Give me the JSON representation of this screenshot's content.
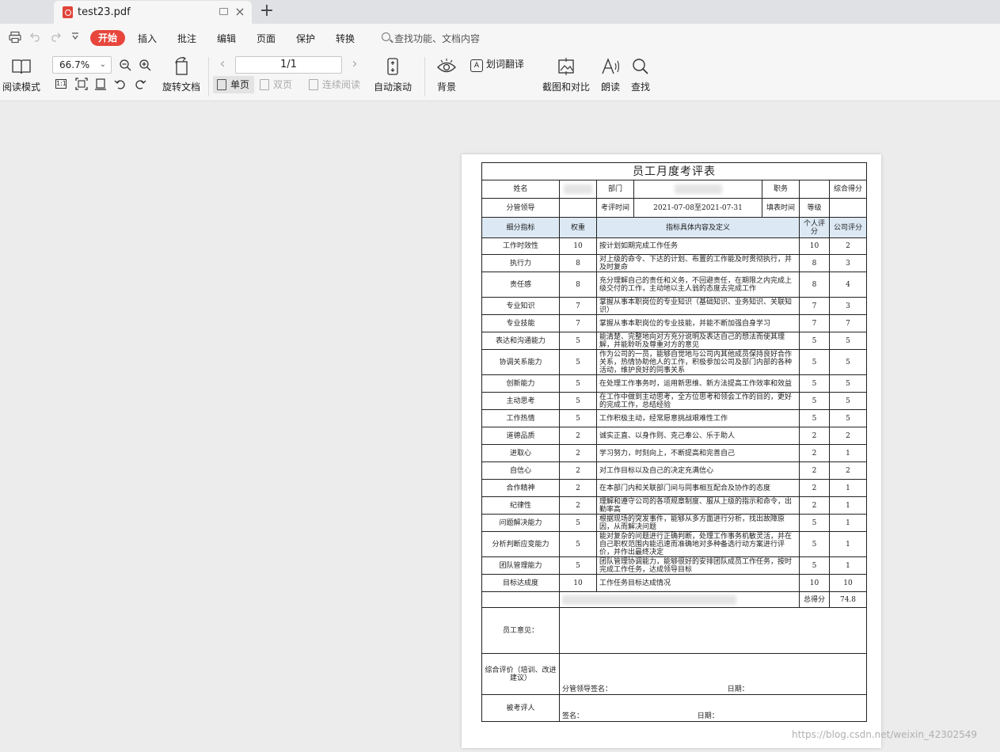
{
  "tab": {
    "title": "test23.pdf",
    "close_glyph": "×",
    "add_glyph": "+"
  },
  "menu": {
    "start": "开始",
    "items": [
      "插入",
      "批注",
      "编辑",
      "页面",
      "保护",
      "转换"
    ],
    "search_placeholder": "查找功能、文档内容"
  },
  "toolbar": {
    "reading_mode": "阅读模式",
    "zoom": "66.7%",
    "rotate_doc": "旋转文档",
    "page_indicator": "1/1",
    "single_page": "单页",
    "double_page": "双页",
    "continuous": "连续阅读",
    "auto_scroll": "自动滚动",
    "background": "背景",
    "translate": "划词翻译",
    "screenshot_compare": "截图和对比",
    "read_aloud": "朗读",
    "find": "查找"
  },
  "form": {
    "title": "员工月度考评表",
    "name_label": "姓名",
    "dept_label": "部门",
    "position_label": "职务",
    "overall_score_label": "综合得分",
    "supervisor_label": "分管领导",
    "eval_period_label": "考评时间",
    "eval_period": "2021-07-08至2021-07-31",
    "fill_time_label": "填表时间",
    "grade_label": "等级",
    "col_indicator": "细分指标",
    "col_weight": "权重",
    "col_definition": "指标具体内容及定义",
    "col_self": "个人评分",
    "col_company": "公司评分",
    "rows": [
      {
        "indicator": "工作时效性",
        "weight": "10",
        "definition": "按计划如期完成工作任务",
        "self": "10",
        "company": "2"
      },
      {
        "indicator": "执行力",
        "weight": "8",
        "definition": "对上级的命令、下达的计划、布置的工作能及时贯彻执行，并及时复命",
        "self": "8",
        "company": "3"
      },
      {
        "indicator": "责任感",
        "weight": "8",
        "definition": "充分理解自己的责任和义务，不回避责任，在期限之内完成上级交付的工作，主动地以主人翁的态度去完成工作",
        "self": "8",
        "company": "4"
      },
      {
        "indicator": "专业知识",
        "weight": "7",
        "definition": "掌握从事本职岗位的专业知识（基础知识、业务知识、关联知识）",
        "self": "7",
        "company": "3"
      },
      {
        "indicator": "专业技能",
        "weight": "7",
        "definition": "掌握从事本职岗位的专业技能，并能不断加强自身学习",
        "self": "7",
        "company": "7"
      },
      {
        "indicator": "表达和沟通能力",
        "weight": "5",
        "definition": "能清楚、完整地向对方充分说明及表达自己的想法而使其理解，并能聆听及尊重对方的意见",
        "self": "5",
        "company": "5"
      },
      {
        "indicator": "协调关系能力",
        "weight": "5",
        "definition": "作为公司的一员，能够自觉地与公司内其他成员保持良好合作关系，热情协助他人的工作，积极参加公司及部门内部的各种活动，维护良好的同事关系",
        "self": "5",
        "company": "5"
      },
      {
        "indicator": "创新能力",
        "weight": "5",
        "definition": "在处理工作事务时，运用新思维、新方法提高工作效率和效益",
        "self": "5",
        "company": "5"
      },
      {
        "indicator": "主动思考",
        "weight": "5",
        "definition": "在工作中做到主动思考，全方位思考和领会工作的目的，更好的完成工作，总结经验",
        "self": "5",
        "company": "5"
      },
      {
        "indicator": "工作热情",
        "weight": "5",
        "definition": "工作积极主动，经常愿意挑战艰难性工作",
        "self": "5",
        "company": "5"
      },
      {
        "indicator": "道德品质",
        "weight": "2",
        "definition": "诚实正直、以身作则、克己奉公、乐于助人",
        "self": "2",
        "company": "2"
      },
      {
        "indicator": "进取心",
        "weight": "2",
        "definition": "学习努力，时刻向上，不断提高和完善自己",
        "self": "2",
        "company": "1"
      },
      {
        "indicator": "自信心",
        "weight": "2",
        "definition": "对工作目标以及自己的决定充满信心",
        "self": "2",
        "company": "2"
      },
      {
        "indicator": "合作精神",
        "weight": "2",
        "definition": "在本部门内和关联部门间与同事相互配合及协作的态度",
        "self": "2",
        "company": "1"
      },
      {
        "indicator": "纪律性",
        "weight": "2",
        "definition": "理解和遵守公司的各项规章制度、服从上级的指示和命令，出勤率高",
        "self": "2",
        "company": "1"
      },
      {
        "indicator": "问题解决能力",
        "weight": "5",
        "definition": "根据现场的突发事件，能够从多方面进行分析，找出故障原因，从而解决问题",
        "self": "5",
        "company": "1"
      },
      {
        "indicator": "分析判断应变能力",
        "weight": "5",
        "definition": "能对复杂的问题进行正确判断，处理工作事务机敏灵活，并在自己职权范围内能迅速而准确地对多种备选行动方案进行评价，并作出最终决定",
        "self": "5",
        "company": "1"
      },
      {
        "indicator": "团队管理能力",
        "weight": "5",
        "definition": "团队管理协调能力，能够很好的安排团队成员工作任务，按时完成工作任务，达成领导目标",
        "self": "5",
        "company": "1"
      },
      {
        "indicator": "目标达成度",
        "weight": "10",
        "definition": "工作任务目标达成情况",
        "self": "10",
        "company": "10"
      }
    ],
    "total_label": "总得分",
    "total_value": "74.8",
    "employee_opinion_label": "员工意见：",
    "overall_eval_label": "综合评价（培训、改进建议）",
    "supervisor_sign": "分管领导签名：",
    "date_label": "日期：",
    "appraisee_label": "被考评人",
    "sign_label": "签名："
  },
  "watermark": "https://blog.csdn.net/weixin_42302549"
}
